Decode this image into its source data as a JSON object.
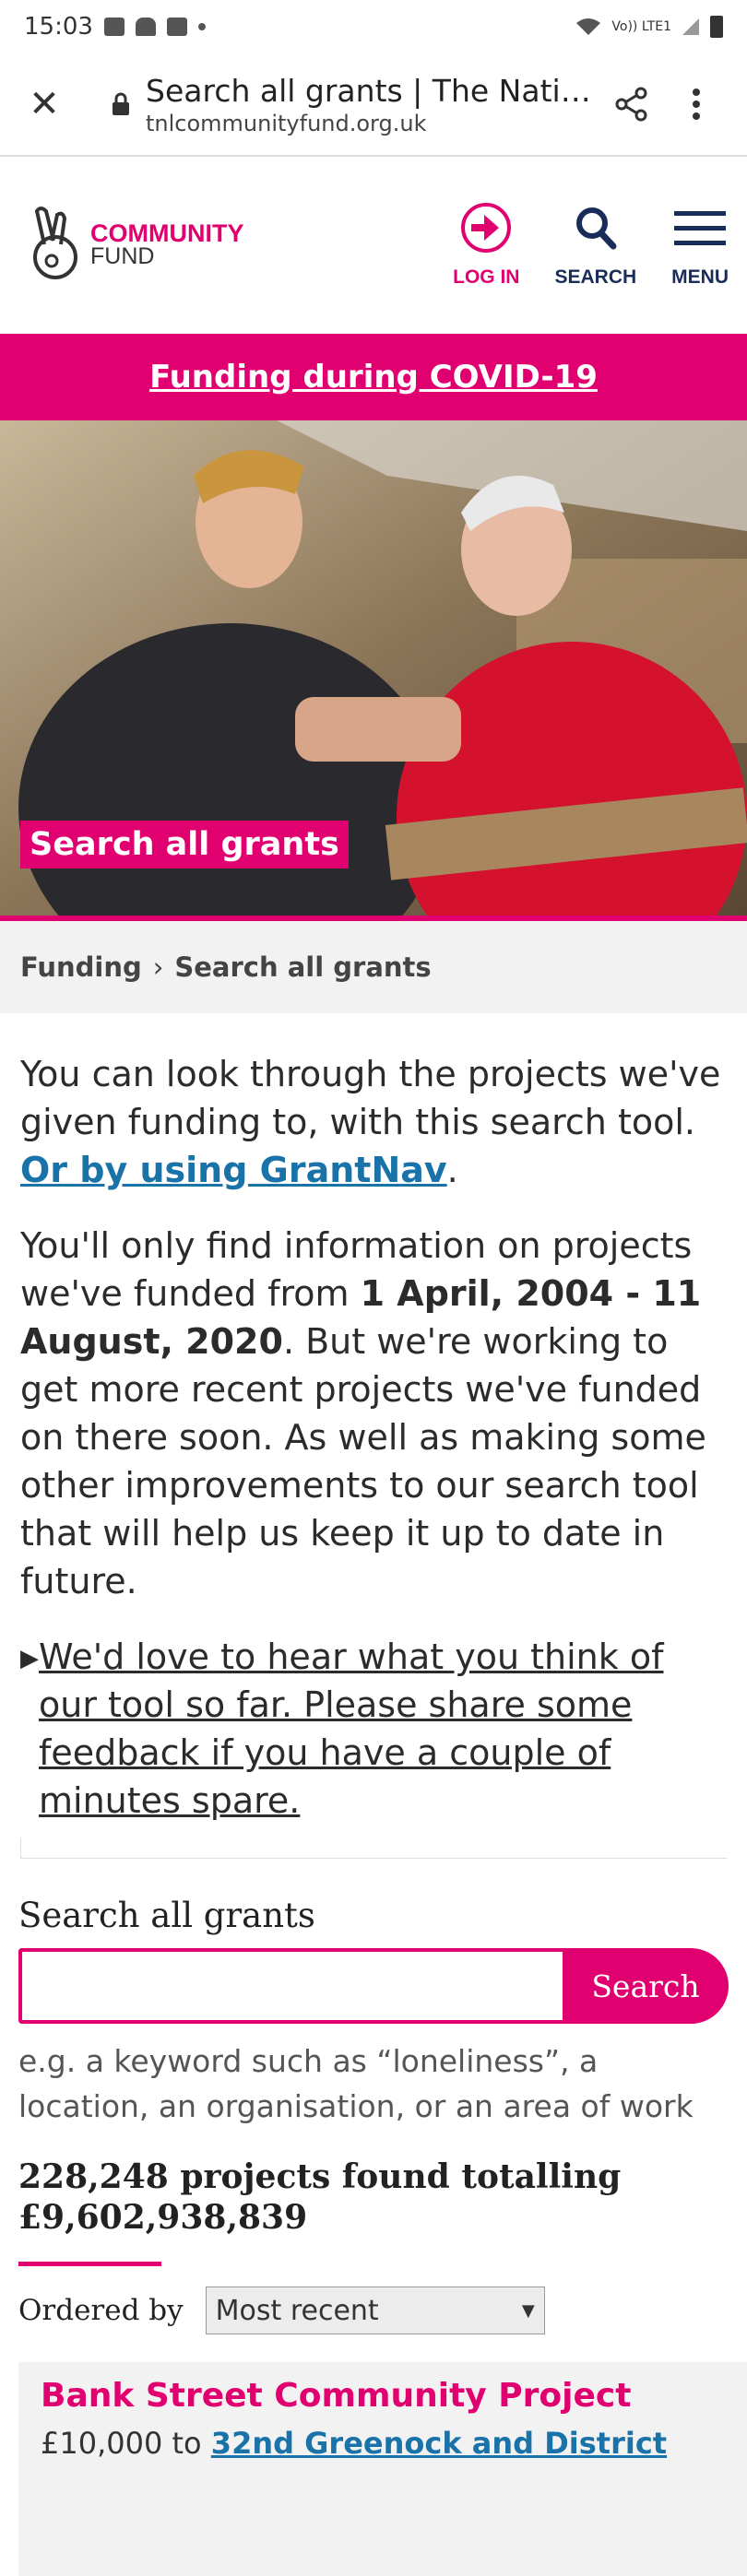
{
  "status_bar": {
    "time": "15:03",
    "network": "Vo)) LTE1"
  },
  "browser": {
    "page_title": "Search all grants | The National Lottery Community Fund",
    "host": "tnlcommunityfund.org.uk"
  },
  "header": {
    "logo_line1": "COMMUNITY",
    "logo_line2": "FUND",
    "nav": {
      "login": "LOG IN",
      "search": "SEARCH",
      "menu": "MENU"
    }
  },
  "covid_banner": "Funding during COVID-19",
  "hero": {
    "label": "Search all grants"
  },
  "breadcrumb": {
    "items": [
      "Funding",
      "Search all grants"
    ],
    "separator": "›"
  },
  "intro": {
    "p1_text": "You can look through the projects we've given funding to, with this search tool. ",
    "p1_link": "Or by using GrantNav",
    "p1_end": ".",
    "p2_start": "You'll only find information on projects we've funded from ",
    "p2_bold": "1 April, 2004 - 11 August, 2020",
    "p2_end": ". But we're working to get more recent projects we've funded on there soon. As well as making some other improvements to our search tool that will help us keep it up to date in future.",
    "feedback_link": "We'd love to hear what you think of our tool so far. Please share some feedback if you have a couple of minutes spare."
  },
  "search": {
    "title": "Search all grants",
    "input_value": "",
    "button": "Search",
    "hint": "e.g. a keyword such as “loneliness”, a location, an organisation, or an area of work"
  },
  "results": {
    "count_text": "228,248 projects found totalling £9,602,938,839",
    "order_label": "Ordered by",
    "order_selected": "Most recent",
    "items": [
      {
        "title": "Bank Street Community Project",
        "amount": "£10,000",
        "to_word": "to",
        "recipient": "32nd Greenock and District"
      }
    ]
  },
  "colors": {
    "brand_pink": "#e0006f",
    "navy": "#1a2d5a",
    "link_blue": "#1a73a8"
  }
}
